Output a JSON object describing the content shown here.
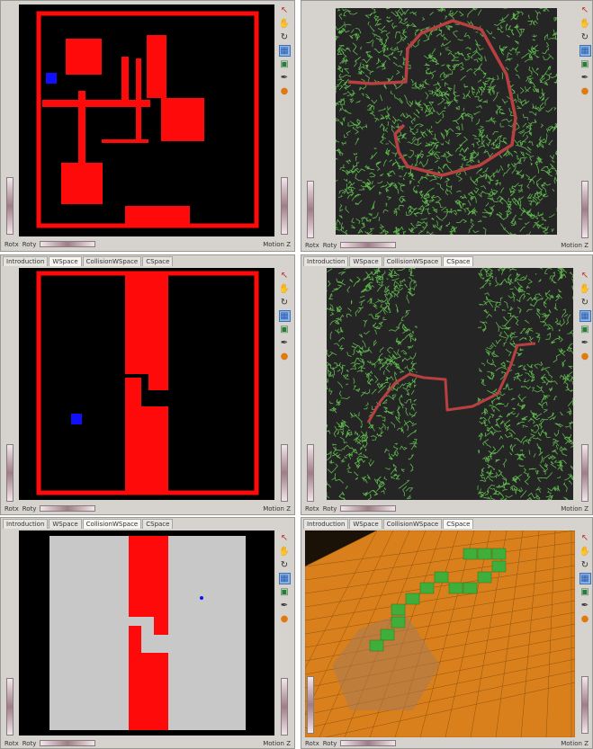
{
  "tabs": [
    "Introduction",
    "WSpace",
    "CollisionWSpace",
    "CSpace"
  ],
  "toolbar_icons": [
    "pointer-icon",
    "hand-icon",
    "rotate-icon",
    "grid-view-icon",
    "camera-icon",
    "pin-icon",
    "color-ball-icon"
  ],
  "bottom": {
    "rotx": "Rotx",
    "roty": "Roty",
    "motion_z": "Motion Z"
  },
  "colors": {
    "obstacle": "#ff0a0a",
    "robot": "#1010ff",
    "tree": "#5fb84e",
    "path": "#b94040",
    "cspace_floor": "#d9801c",
    "cspace_free": "#3fae3b",
    "free_space": "#c8c8c8"
  },
  "panels": [
    {
      "id": "p1",
      "show_tabs": false,
      "active_tab": -1
    },
    {
      "id": "p2",
      "show_tabs": false,
      "active_tab": -1
    },
    {
      "id": "p3",
      "show_tabs": true,
      "active_tab": 1
    },
    {
      "id": "p4",
      "show_tabs": true,
      "active_tab": 3
    },
    {
      "id": "p5",
      "show_tabs": true,
      "active_tab": 2
    },
    {
      "id": "p6",
      "show_tabs": true,
      "active_tab": 3
    }
  ]
}
